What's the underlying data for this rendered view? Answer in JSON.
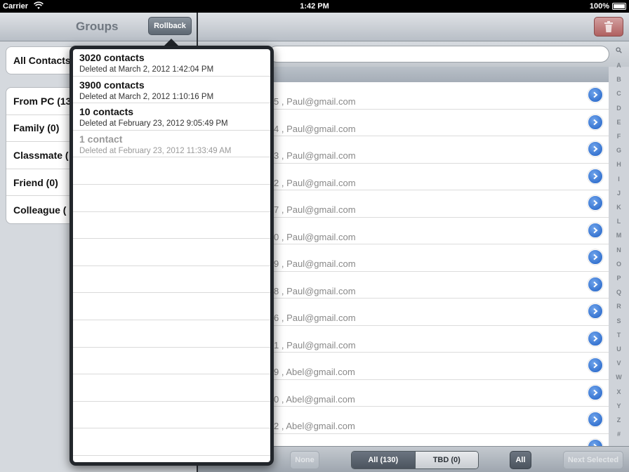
{
  "status_bar": {
    "carrier": "Carrier",
    "time": "1:42 PM",
    "battery": "100%"
  },
  "left_pane": {
    "title": "Groups",
    "rollback_label": "Rollback",
    "all_contacts": "All Contacts",
    "groups": [
      "From PC (13",
      "Family (0)",
      "Classmate (",
      "Friend (0)",
      "Colleague ("
    ]
  },
  "popover": {
    "items": [
      {
        "name": "3020 contacts",
        "deleted": "Deleted at March 2, 2012 1:42:04 PM",
        "dim": false
      },
      {
        "name": "3900 contacts",
        "deleted": "Deleted at March 2, 2012 1:10:16 PM",
        "dim": false
      },
      {
        "name": "10 contacts",
        "deleted": "Deleted at February 23, 2012 9:05:49 PM",
        "dim": false
      },
      {
        "name": "1 contact",
        "deleted": "Deleted at February 23, 2012 11:33:49 AM",
        "dim": true
      }
    ],
    "empty_rows": 11
  },
  "contacts": [
    {
      "email": "5 , Paul@gmail.com"
    },
    {
      "email": "4 , Paul@gmail.com"
    },
    {
      "email": "3 , Paul@gmail.com"
    },
    {
      "email": "2 , Paul@gmail.com"
    },
    {
      "email": "7 , Paul@gmail.com"
    },
    {
      "email": "0 , Paul@gmail.com"
    },
    {
      "email": "9 , Paul@gmail.com"
    },
    {
      "email": "8 , Paul@gmail.com"
    },
    {
      "email": "6 , Paul@gmail.com"
    },
    {
      "email": "1 , Paul@gmail.com"
    },
    {
      "email": "9 , Abel@gmail.com"
    },
    {
      "email": "0 , Abel@gmail.com"
    },
    {
      "email": "2 , Abel@gmail.com"
    },
    {
      "email": ""
    }
  ],
  "index_letters": [
    "Q",
    "A",
    "B",
    "C",
    "D",
    "E",
    "F",
    "G",
    "H",
    "I",
    "J",
    "K",
    "L",
    "M",
    "N",
    "O",
    "P",
    "Q",
    "R",
    "S",
    "T",
    "U",
    "V",
    "W",
    "X",
    "Y",
    "Z",
    "#"
  ],
  "toolbar": {
    "none_label": "None",
    "all_count_label": "All (130)",
    "tbd_label": "TBD (0)",
    "all_label": "All",
    "next_selected_label": "Next Selected"
  },
  "icons": {
    "trash": "trash-icon",
    "search": "search-icon",
    "disclosure": "chevron-right-icon",
    "wifi": "wifi-icon"
  },
  "colors": {
    "disclosure_blue": "#2060c4",
    "popover_frame": "#22262b",
    "trash_red": "#b06060"
  }
}
